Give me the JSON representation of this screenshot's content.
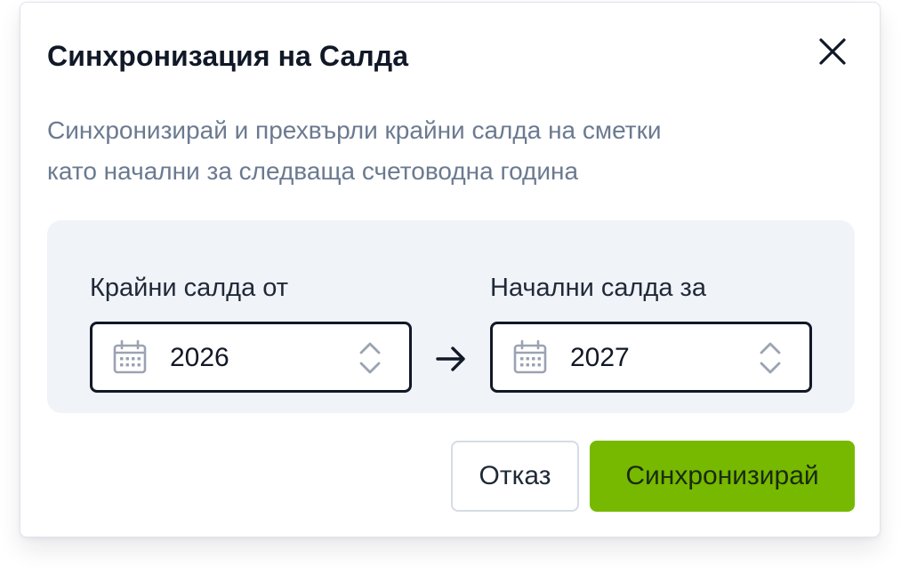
{
  "dialog": {
    "title": "Синхронизация на Салда",
    "description_line1": "Синхронизирай и прехвърли крайни салда на сметки",
    "description_line2": "като начални за следваща счетоводна година",
    "close_icon": "close-icon"
  },
  "from": {
    "label": "Крайни салда от",
    "value": "2026",
    "icon": "calendar-icon"
  },
  "to": {
    "label": "Начални салда за",
    "value": "2027",
    "icon": "calendar-icon"
  },
  "arrow_icon": "arrow-right-icon",
  "buttons": {
    "cancel_label": "Отказ",
    "sync_label": "Синхронизирай"
  },
  "colors": {
    "primary": "#76b900",
    "title": "#111827",
    "muted_text": "#6b7a90",
    "panel_bg": "#f0f3f8",
    "border_dark": "#111827"
  }
}
